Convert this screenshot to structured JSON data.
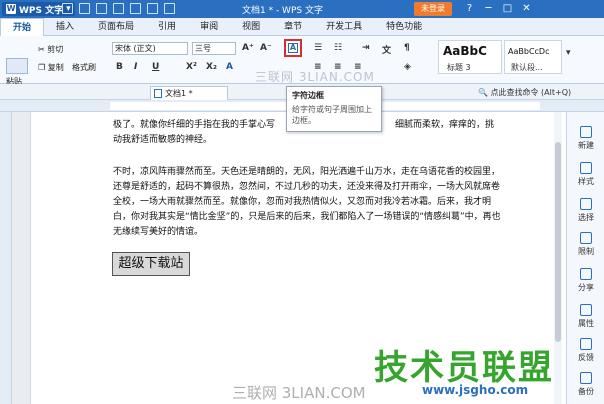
{
  "titlebar": {
    "app_name": "WPS 文字",
    "doc_title": "文档1 * - WPS 文字",
    "login_label": "未登录",
    "controls": [
      "?",
      "─",
      "□",
      "✕"
    ]
  },
  "tabs": [
    "开始",
    "插入",
    "页面布局",
    "引用",
    "审阅",
    "视图",
    "章节",
    "开发工具",
    "特色功能"
  ],
  "ribbon": {
    "paste": "粘贴",
    "cut": "剪切",
    "copy": "复制",
    "format_painter": "格式刷",
    "font_name": "宋体 (正文)",
    "font_size": "三号",
    "bold": "B",
    "italic": "I",
    "underline": "U",
    "superscript": "X²",
    "subscript": "X₂",
    "char_border": "A",
    "style1_preview": "AaBbC",
    "style1_name": "标题 3",
    "style2_preview": "AaBbCcDc",
    "style2_name": "默认段..."
  },
  "toolbar2": {
    "doc_tab": "文档1 *",
    "search": "点此查找命令 (Alt+Q)"
  },
  "tooltip": {
    "title": "字符边框",
    "desc": "给字符或句子周围加上边框。"
  },
  "document": {
    "para1_line1": "极了。就像你纤细的手指在我的手掌心写",
    "para1_line1_right": "细腻而柔软，痒痒的，挑",
    "para1_line2": "动我舒适而敏感的神经。",
    "para2": "不时，凉风阵雨骤然而至。天色还是晴朗的，无风，阳光洒遍千山万水，走在乌语花香的校园里，还尊是舒适的，起码不算很热，忽然间，不过几秒的功夫，还没来得及打开雨伞，一场大风就席卷全校，一场大雨就骤然而至。就像你，忽而对我热情似火，又忽而对我冷若冰霜。后来，我才明白，你对我其实是“情比金坚”的，只是后来的后来，我们都陷入了一场错误的“情感纠葛”中，再也无缘续写美好的情谊。",
    "boxed_text": "超级下载站"
  },
  "taskpane": [
    "新建",
    "样式",
    "选择",
    "限制",
    "分享",
    "属性",
    "反馈",
    "备份"
  ],
  "watermarks": {
    "mid": "三联网 3LIAN.COM",
    "bottom": "三联网 3LIAN.COM",
    "logo": "技术员联盟",
    "url": "www.jsgho.com"
  }
}
